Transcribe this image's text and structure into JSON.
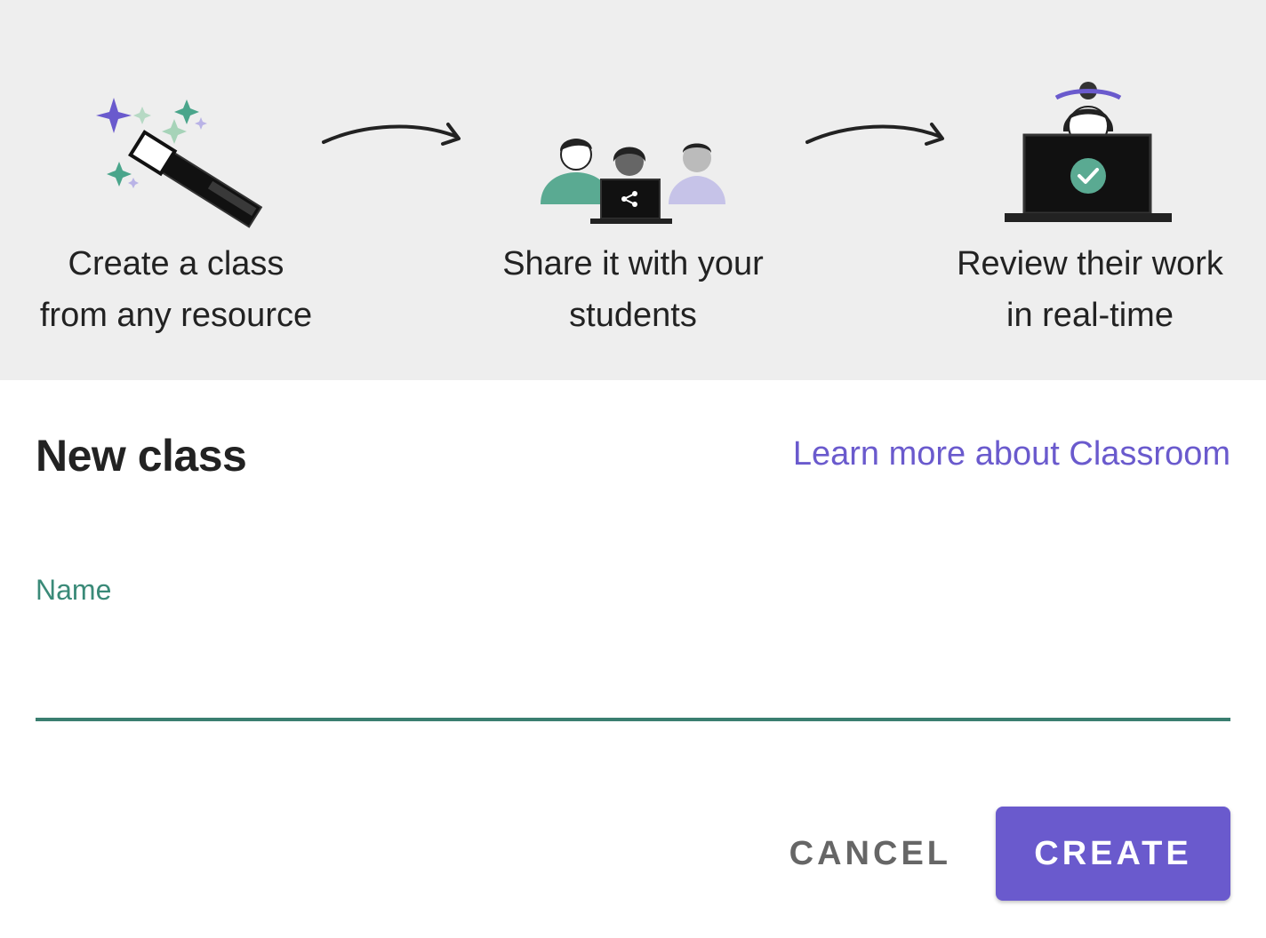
{
  "banner": {
    "steps": [
      {
        "icon": "magic-wand-icon",
        "line1": "Create a class",
        "line2": "from any resource"
      },
      {
        "icon": "share-laptop-icon",
        "line1": "Share it with your",
        "line2": "students"
      },
      {
        "icon": "review-laptop-icon",
        "line1": "Review their work",
        "line2": "in real-time"
      }
    ]
  },
  "form": {
    "title": "New class",
    "learn_more_link": "Learn more about Classroom",
    "name_label": "Name",
    "name_value": "",
    "cancel_label": "CANCEL",
    "create_label": "CREATE"
  },
  "colors": {
    "accent_purple": "#6a5acd",
    "accent_green": "#3a8a78",
    "banner_bg": "#eeeeee"
  }
}
